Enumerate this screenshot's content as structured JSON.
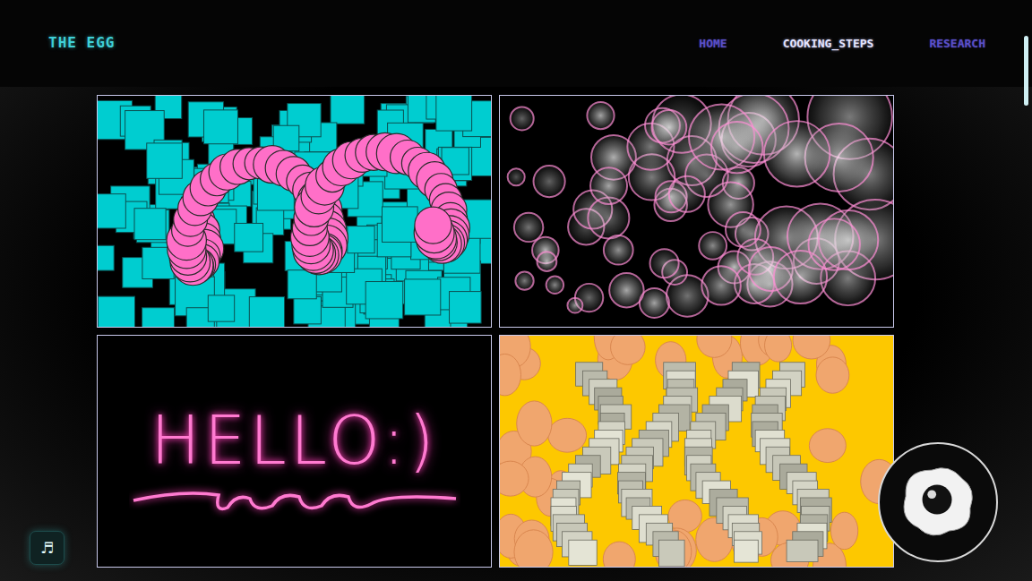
{
  "header": {
    "logo": "THE EGG",
    "nav": [
      {
        "label": "HOME",
        "selected": false
      },
      {
        "label": "COOKING_STEPS",
        "selected": true
      },
      {
        "label": "RESEARCH",
        "selected": false
      }
    ]
  },
  "gallery": [
    {
      "kind": "shapes"
    },
    {
      "kind": "bubbles"
    },
    {
      "kind": "neon",
      "text": "HELLO:)"
    },
    {
      "kind": "collage"
    }
  ],
  "music_button": {
    "label": "♬"
  }
}
